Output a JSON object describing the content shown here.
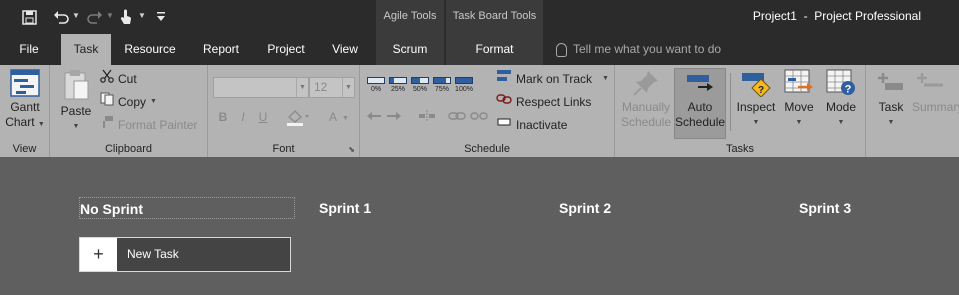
{
  "window": {
    "app_title": "Project1  -  Project Professional"
  },
  "quick_access": {
    "save_icon": "save-icon",
    "undo_icon": "undo-icon",
    "redo_icon": "redo-icon",
    "touch_icon": "touch-mode-icon",
    "customize_icon": "customize-toolbar-icon"
  },
  "context_groups": {
    "agile_tools": "Agile Tools",
    "task_board_tools": "Task Board Tools"
  },
  "tabs": [
    {
      "label": "File"
    },
    {
      "label": "Task"
    },
    {
      "label": "Resource"
    },
    {
      "label": "Report"
    },
    {
      "label": "Project"
    },
    {
      "label": "View"
    },
    {
      "label": "Scrum"
    },
    {
      "label": "Format"
    }
  ],
  "tell_me": {
    "placeholder": "Tell me what you want to do"
  },
  "ribbon": {
    "view_group": {
      "label": "View",
      "gantt_chart_line1": "Gantt",
      "gantt_chart_line2": "Chart"
    },
    "clipboard_group": {
      "label": "Clipboard",
      "paste": "Paste",
      "cut": "Cut",
      "copy": "Copy",
      "format_painter": "Format Painter"
    },
    "font_group": {
      "label": "Font",
      "font_size": "12",
      "bold": "B",
      "italic": "I",
      "underline": "U",
      "font_color": "A"
    },
    "schedule_group": {
      "label": "Schedule",
      "pcts": [
        "0%",
        "25%",
        "50%",
        "75%",
        "100%"
      ],
      "mark_on_track": "Mark on Track",
      "respect_links": "Respect Links",
      "inactivate": "Inactivate"
    },
    "tasks_group": {
      "label": "Tasks",
      "manually_schedule_line1": "Manually",
      "manually_schedule_line2": "Schedule",
      "auto_schedule_line1": "Auto",
      "auto_schedule_line2": "Schedule",
      "inspect": "Inspect",
      "move": "Move",
      "mode": "Mode"
    },
    "insert_group": {
      "task": "Task",
      "summary": "Summary"
    }
  },
  "board": {
    "columns": [
      {
        "title": "No Sprint"
      },
      {
        "title": "Sprint 1"
      },
      {
        "title": "Sprint 2"
      },
      {
        "title": "Sprint 3"
      }
    ],
    "new_task_plus": "+",
    "new_task_label": "New Task"
  }
}
